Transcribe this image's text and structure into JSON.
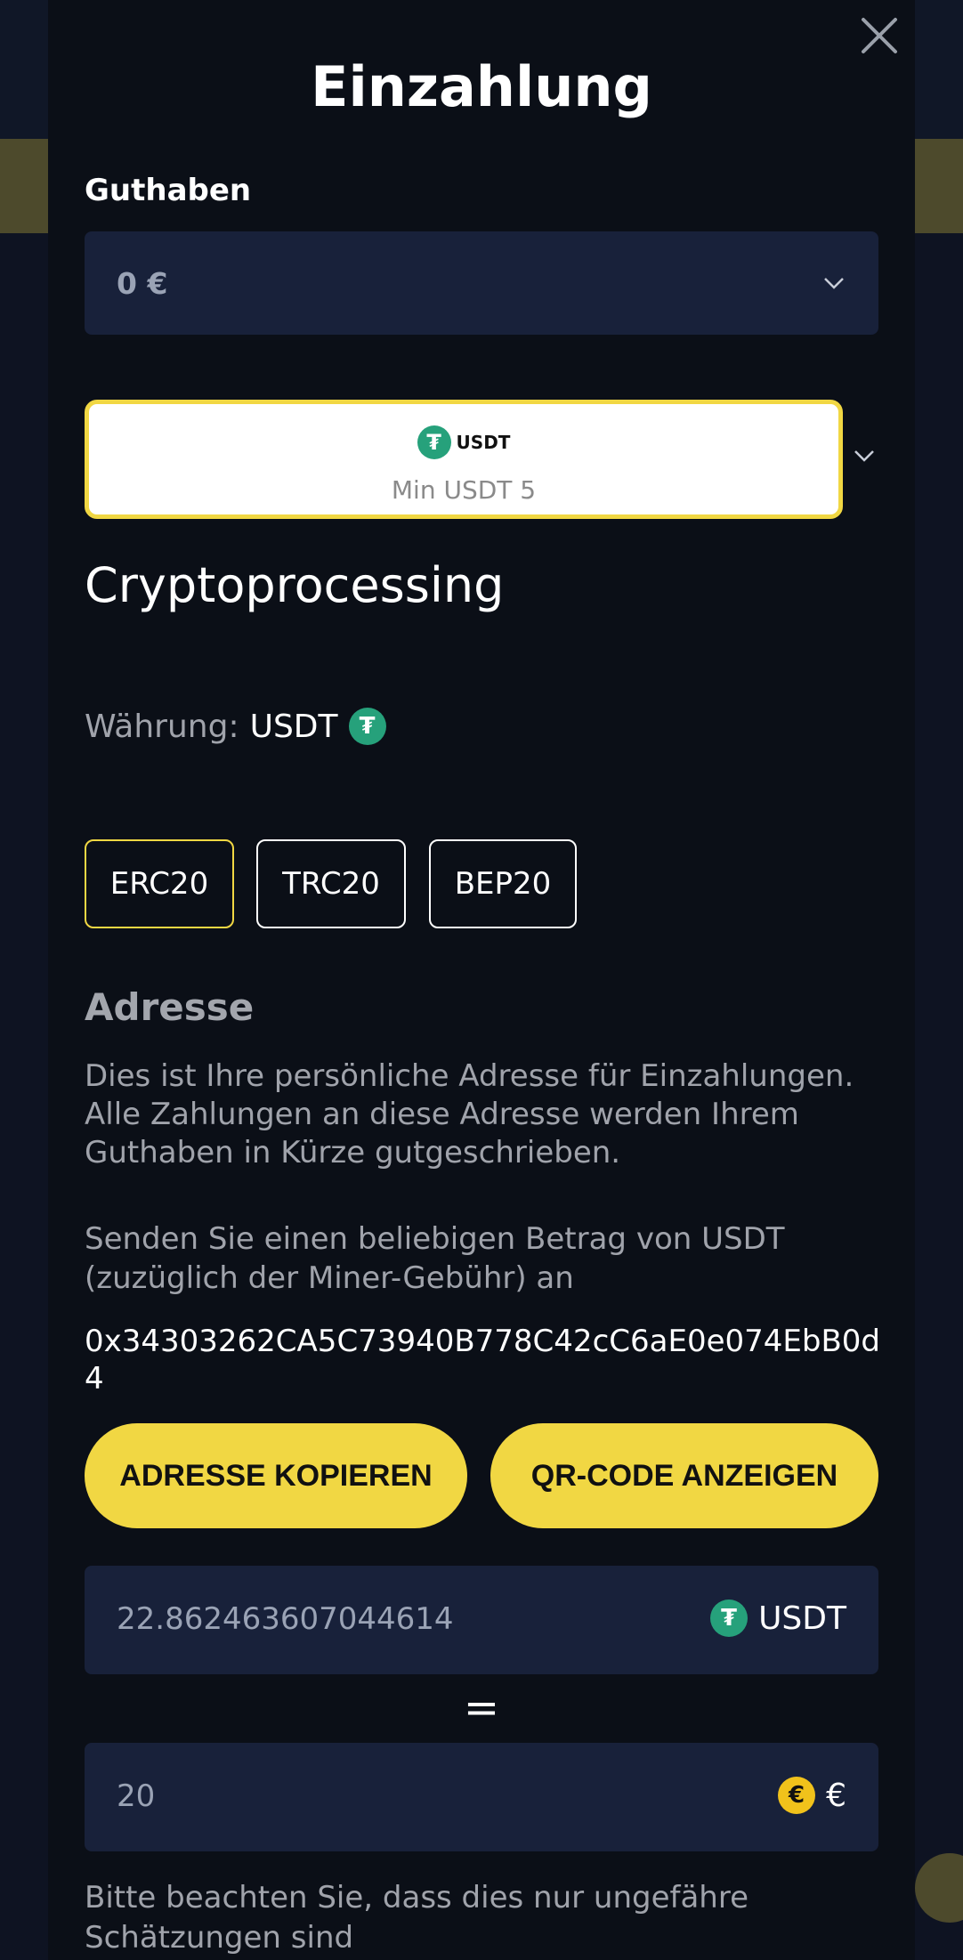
{
  "modal": {
    "title": "Einzahlung",
    "balance_label": "Guthaben",
    "balance_value": "0 €",
    "payment_method": {
      "logo_text": "USDT",
      "min_text": "Min USDT 5"
    },
    "provider_heading": "Cryptoprocessing",
    "currency_label": "Währung:",
    "currency_value": "USDT",
    "networks": [
      {
        "label": "ERC20",
        "active": true
      },
      {
        "label": "TRC20",
        "active": false
      },
      {
        "label": "BEP20",
        "active": false
      }
    ],
    "address_heading": "Adresse",
    "address_description": "Dies ist Ihre persönliche Adresse für Einzahlungen. Alle Zahlungen an diese Adresse werden Ihrem Guthaben in Kürze gutgeschrieben.",
    "send_text": "Senden Sie einen beliebigen Betrag von USDT (zuzüglich der Miner-Gebühr) an",
    "address_value": "0x34303262CA5C73940B778C42cC6aE0e074EbB0d4",
    "copy_button": "ADRESSE KOPIEREN",
    "qr_button": "QR-CODE ANZEIGEN",
    "crypto_amount": "22.862463607044614",
    "crypto_currency": "USDT",
    "equals_sign": "=",
    "fiat_amount": "20",
    "fiat_currency": "€",
    "note": "Bitte beachten Sie, dass dies nur ungefähre Schätzungen sind"
  },
  "colors": {
    "accent_yellow": "#f1d743",
    "tether_green": "#26a17b",
    "modal_bg": "#0b0f17",
    "field_bg": "#18213a"
  }
}
